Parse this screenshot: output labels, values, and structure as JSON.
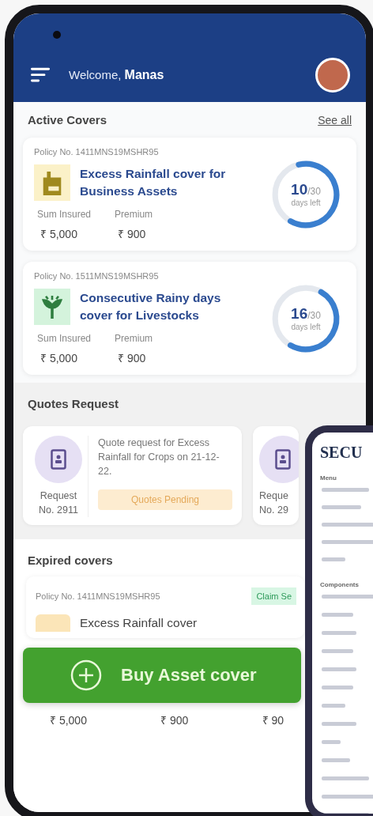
{
  "header": {
    "greeting": "Welcome,",
    "name": "Manas"
  },
  "active_covers": {
    "title": "Active Covers",
    "see_all": "See all",
    "covers": [
      {
        "policy": "Policy No. 1411MNS19MSHR95",
        "kind": "factory",
        "title": "Excess Rainfall cover for Business Assets",
        "sum_label": "Sum Insured",
        "sum": "₹ 5,000",
        "premium_label": "Premium",
        "premium": "₹ 900",
        "days": "10",
        "total": "/30",
        "days_label": "days left",
        "level": 0.62
      },
      {
        "policy": "Policy No. 1511MNS19MSHR95",
        "kind": "livestock",
        "title": "Consecutive Rainy days cover for Livestocks",
        "sum_label": "Sum Insured",
        "sum": "₹ 5,000",
        "premium_label": "Premium",
        "premium": "₹ 900",
        "days": "16",
        "total": "/30",
        "days_label": "days left",
        "level": 0.5
      }
    ]
  },
  "quotes": {
    "title": "Quotes Request",
    "items": [
      {
        "label": "Request",
        "number": "No. 2911",
        "text": "Quote request for Excess Rainfall for Crops on 21-12-22.",
        "status": "Quotes Pending"
      },
      {
        "label": "Reque",
        "number": "No. 29"
      }
    ]
  },
  "expired": {
    "title": "Expired covers",
    "policy": "Policy No. 1411MNS19MSHR95",
    "badge": "Claim Se",
    "cover_title": "Excess Rainfall cover",
    "values": [
      "₹ 5,000",
      "₹ 900",
      "₹ 90"
    ]
  },
  "buy_button": "Buy Asset cover",
  "tablet": {
    "brand": "SECU",
    "menu": "Menu",
    "components": "Components"
  }
}
